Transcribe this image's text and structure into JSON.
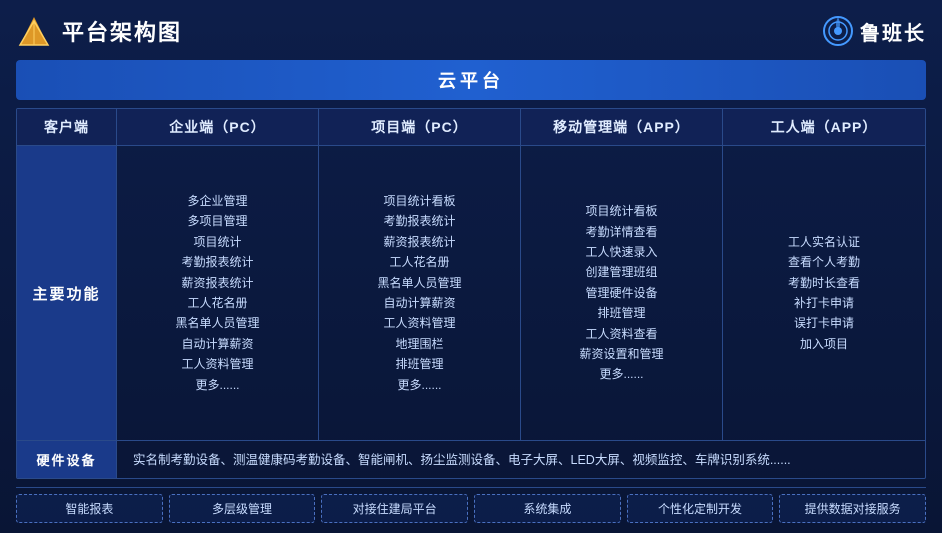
{
  "header": {
    "title": "平台架构图",
    "brand_name": "鲁班长"
  },
  "cloud_platform": {
    "label": "云平台"
  },
  "col_headers": {
    "client": "客户端",
    "enterprise_pc": "企业端（PC）",
    "project_pc": "项目端（PC）",
    "mobile_app": "移动管理端（APP）",
    "worker_app": "工人端（APP）"
  },
  "main_features": {
    "row_label": "主要功能",
    "enterprise_features": [
      "多企业管理",
      "多项目管理",
      "项目统计",
      "考勤报表统计",
      "薪资报表统计",
      "工人花名册",
      "黑名单人员管理",
      "自动计算薪资",
      "工人资料管理",
      "更多......"
    ],
    "project_features": [
      "项目统计看板",
      "考勤报表统计",
      "薪资报表统计",
      "工人花名册",
      "黑名单人员管理",
      "自动计算薪资",
      "工人资料管理",
      "地理围栏",
      "排班管理",
      "更多......"
    ],
    "mobile_features": [
      "项目统计看板",
      "考勤详情查看",
      "工人快速录入",
      "创建管理班组",
      "管理硬件设备",
      "排班管理",
      "工人资料查看",
      "薪资设置和管理",
      "更多......"
    ],
    "worker_features": [
      "工人实名认证",
      "查看个人考勤",
      "考勤时长查看",
      "补打卡申请",
      "误打卡申请",
      "加入项目"
    ]
  },
  "hardware": {
    "label": "硬件设备",
    "content": "实名制考勤设备、测温健康码考勤设备、智能闸机、扬尘监测设备、电子大屏、LED大屏、视频监控、车牌识别系统......"
  },
  "bottom_tags": [
    "智能报表",
    "多层级管理",
    "对接住建局平台",
    "系统集成",
    "个性化定制开发",
    "提供数据对接服务"
  ]
}
